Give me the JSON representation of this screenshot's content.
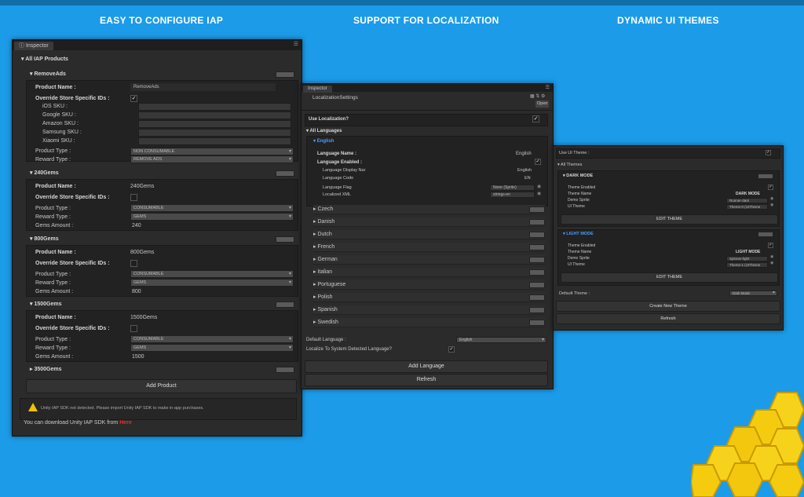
{
  "headings": [
    "EASY TO CONFIGURE IAP",
    "SUPPORT FOR LOCALIZATION",
    "DYNAMIC UI THEMES"
  ],
  "iap": {
    "tab": "Inspector",
    "section": "All IAP Products",
    "products": [
      {
        "name": "RemoveAds",
        "product_name_label": "Product Name :",
        "product_name": "RemoveAds",
        "override_label": "Override Store Specific IDs :",
        "override": true,
        "skus": [
          "iOS SKU :",
          "Google SKU :",
          "Amazon SKU :",
          "Samsung SKU :",
          "Xiaomi SKU :"
        ],
        "type_label": "Product Type :",
        "type": "NON CONSUMABLE",
        "reward_label": "Reward Type :",
        "reward": "REMOVE ADS"
      },
      {
        "name": "240Gems",
        "product_name_label": "Product Name :",
        "product_name": "240Gems",
        "override_label": "Override Store Specific IDs :",
        "override": false,
        "type_label": "Product Type :",
        "type": "CONSUMABLE",
        "reward_label": "Reward Type :",
        "reward": "GEMS",
        "amount_label": "Gems Amount :",
        "amount": "240"
      },
      {
        "name": "800Gems",
        "product_name_label": "Product Name :",
        "product_name": "800Gems",
        "override_label": "Override Store Specific IDs :",
        "override": false,
        "type_label": "Product Type :",
        "type": "CONSUMABLE",
        "reward_label": "Reward Type :",
        "reward": "GEMS",
        "amount_label": "Gems Amount :",
        "amount": "800"
      },
      {
        "name": "1500Gems",
        "product_name_label": "Product Name :",
        "product_name": "1500Gems",
        "override_label": "Override Store Specific IDs :",
        "override": false,
        "type_label": "Product Type :",
        "type": "CONSUMABLE",
        "reward_label": "Reward Type :",
        "reward": "GEMS",
        "amount_label": "Gems Amount :",
        "amount": "1500"
      },
      {
        "name": "3500Gems"
      }
    ],
    "add_product": "Add Product",
    "warning": "Unity IAP SDK not detected. Please import Unity IAP SDK to make in-app purchases.",
    "download_text": "You can download Unity IAP SDK from",
    "download_link": "Here"
  },
  "loc": {
    "tab": "Inspector",
    "title": "LocalizationSettings",
    "open": "Open",
    "use_label": "Use Localization?",
    "use": true,
    "section": "All Languages",
    "english": {
      "name": "English",
      "lang_name_label": "Language Name :",
      "lang_name": "English",
      "enabled_label": "Language Enabled :",
      "enabled": true,
      "display_label": "Language Display Nar",
      "display": "English",
      "code_label": "Language Code",
      "code": "EN",
      "flag_label": "Language Flag",
      "flag": "None (Sprite)",
      "xml_label": "Localized XML",
      "xml": "strings-en"
    },
    "languages": [
      "Czech",
      "Danish",
      "Dutch",
      "French",
      "German",
      "Italian",
      "Portuguese",
      "Polish",
      "Spanish",
      "Swedish"
    ],
    "default_label": "Default Language :",
    "default": "English",
    "system_label": "Localize To System Detected Language?",
    "system": true,
    "add_language": "Add Language",
    "refresh": "Refresh"
  },
  "themes": {
    "use_label": "Use UI Theme :",
    "use": true,
    "section": "All Themes",
    "items": [
      {
        "title": "DARK MODE",
        "enabled_label": "Theme Enabled",
        "enabled": true,
        "name_label": "Theme Name",
        "name": "DARK MODE",
        "sprite_label": "Demo Sprite",
        "sprite": "Runner-dark",
        "theme_label": "UI Theme",
        "theme": "Theme-0 (UITheme",
        "edit": "EDIT THEME"
      },
      {
        "title": "LIGHT MODE",
        "enabled_label": "Theme Enabled",
        "enabled": true,
        "name_label": "Theme Name",
        "name": "LIGHT MODE",
        "sprite_label": "Demo Sprite",
        "sprite": "Spinner-light",
        "theme_label": "UI Theme",
        "theme": "Theme-1 (UITheme",
        "edit": "EDIT THEME"
      }
    ],
    "default_label": "Default Theme :",
    "default": "Dark Mode",
    "create": "Create New Theme",
    "refresh": "Refresh"
  },
  "colors": {
    "background": "#1c9be8",
    "panel": "#2b2b2b",
    "accent_blue": "#4a9cff",
    "link_red": "#e03030",
    "hex_yellow": "#f7d21a"
  }
}
